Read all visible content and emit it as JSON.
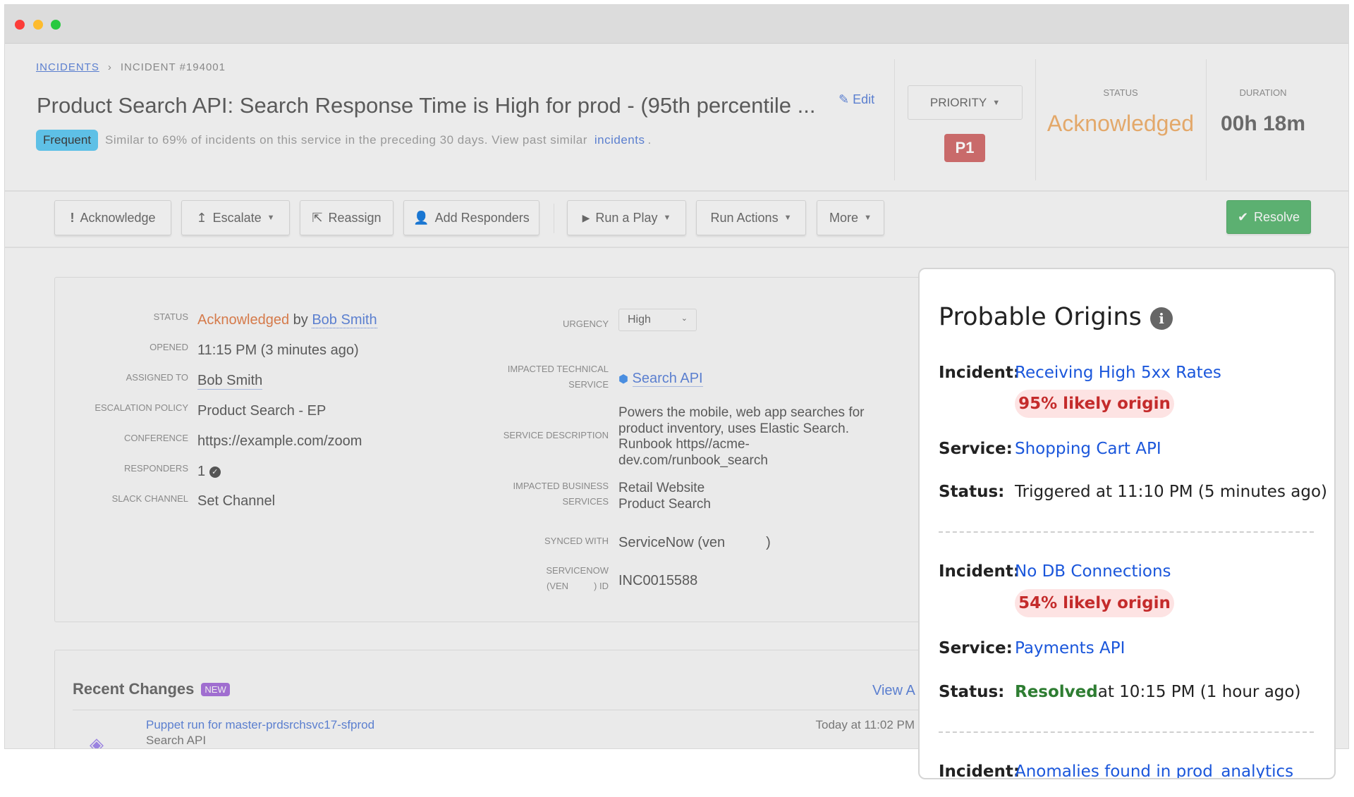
{
  "breadcrumb": {
    "root": "INCIDENTS",
    "current": "INCIDENT #194001"
  },
  "header": {
    "title": "Product Search API: Search Response Time is High for prod - (95th percentile ...",
    "edit": "Edit",
    "badge": "Frequent",
    "similar_text": "Similar to 69% of incidents on this service in the preceding 30 days. View past similar",
    "similar_link": "incidents",
    "similar_end": ".",
    "priority_label": "PRIORITY",
    "priority_value": "P1",
    "status_label": "STATUS",
    "status_value": "Acknowledged",
    "duration_label": "DURATION",
    "duration_value": "00h 18m"
  },
  "toolbar": {
    "acknowledge": "Acknowledge",
    "escalate": "Escalate",
    "reassign": "Reassign",
    "add_responders": "Add Responders",
    "run_play": "Run a Play",
    "run_actions": "Run Actions",
    "more": "More",
    "resolve": "Resolve"
  },
  "details": {
    "status_label": "STATUS",
    "status_value": "Acknowledged",
    "status_by": "by",
    "status_user": "Bob Smith",
    "opened_label": "OPENED",
    "opened_value": "11:15 PM (3 minutes ago)",
    "assigned_label": "ASSIGNED TO",
    "assigned_value": "Bob Smith",
    "escalation_label": "ESCALATION POLICY",
    "escalation_value": "Product Search - EP",
    "conference_label": "CONFERENCE",
    "conference_value": "https://example.com/zoom",
    "responders_label": "RESPONDERS",
    "responders_value": "1",
    "slack_label": "SLACK CHANNEL",
    "slack_value": "Set Channel",
    "urgency_label": "URGENCY",
    "urgency_value": "High",
    "tech_service_label1": "IMPACTED TECHNICAL",
    "tech_service_label2": "SERVICE",
    "tech_service_value": "Search API",
    "desc_label": "SERVICE DESCRIPTION",
    "desc_lines": [
      "Powers the mobile, web app searches for",
      "product inventory, uses Elastic Search.",
      "Runbook https//acme-",
      "dev.com/runbook_search"
    ],
    "biz_label1": "IMPACTED BUSINESS",
    "biz_label2": "SERVICES",
    "biz_values": [
      "Retail Website",
      "Product Search"
    ],
    "synced_label": "SYNCED WITH",
    "synced_value": "ServiceNow (ven",
    "synced_close": ")",
    "sn_label1": "SERVICENOW",
    "sn_label2a": "(VEN",
    "sn_label2b": ") ID",
    "sn_value": "INC0015588"
  },
  "recent": {
    "title": "Recent Changes",
    "badge": "NEW",
    "view_all": "View A",
    "item_title": "Puppet run for master-prdsrchsvc17-sfprod",
    "item_sub": "Search API",
    "item_time": "Today at 11:02 PM"
  },
  "origins": {
    "title": "Probable Origins",
    "incident_label": "Incident:",
    "service_label": "Service:",
    "status_label": "Status:",
    "items": [
      {
        "incident": "Receiving High 5xx Rates",
        "likelihood": "95% likely origin",
        "service": "Shopping Cart API",
        "status_text": "Triggered at 11:10 PM (5 minutes ago)"
      },
      {
        "incident": "No DB Connections",
        "likelihood": "54% likely origin",
        "service": "Payments API",
        "status_word": "Resolved",
        "status_text": "at 10:15 PM (1 hour ago)"
      },
      {
        "incident": "Anomalies found in prod_analytics"
      }
    ]
  },
  "colors": {
    "link": "#5b7fcf",
    "acknowledged": "#e3a86a",
    "resolve": "#5cb071",
    "priority": "#c96a6a",
    "origin_link": "#1a56db"
  }
}
